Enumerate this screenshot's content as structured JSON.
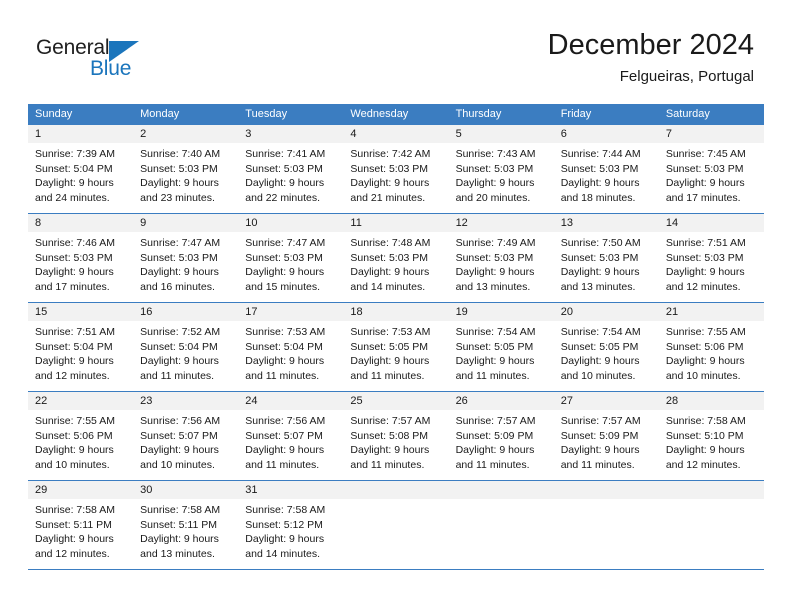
{
  "brand": {
    "word_one": "General",
    "word_two": "Blue",
    "accent_color": "#1b75bc",
    "logo_icon": "triangle-icon"
  },
  "header": {
    "title": "December 2024",
    "subtitle": "Felgueiras, Portugal"
  },
  "calendar": {
    "header_bg": "#3b7dc1",
    "day_number_bg": "#f2f2f2",
    "weekdays": [
      "Sunday",
      "Monday",
      "Tuesday",
      "Wednesday",
      "Thursday",
      "Friday",
      "Saturday"
    ],
    "weeks": [
      [
        {
          "day": "1",
          "sunrise": "Sunrise: 7:39 AM",
          "sunset": "Sunset: 5:04 PM",
          "daylight_1": "Daylight: 9 hours",
          "daylight_2": "and 24 minutes."
        },
        {
          "day": "2",
          "sunrise": "Sunrise: 7:40 AM",
          "sunset": "Sunset: 5:03 PM",
          "daylight_1": "Daylight: 9 hours",
          "daylight_2": "and 23 minutes."
        },
        {
          "day": "3",
          "sunrise": "Sunrise: 7:41 AM",
          "sunset": "Sunset: 5:03 PM",
          "daylight_1": "Daylight: 9 hours",
          "daylight_2": "and 22 minutes."
        },
        {
          "day": "4",
          "sunrise": "Sunrise: 7:42 AM",
          "sunset": "Sunset: 5:03 PM",
          "daylight_1": "Daylight: 9 hours",
          "daylight_2": "and 21 minutes."
        },
        {
          "day": "5",
          "sunrise": "Sunrise: 7:43 AM",
          "sunset": "Sunset: 5:03 PM",
          "daylight_1": "Daylight: 9 hours",
          "daylight_2": "and 20 minutes."
        },
        {
          "day": "6",
          "sunrise": "Sunrise: 7:44 AM",
          "sunset": "Sunset: 5:03 PM",
          "daylight_1": "Daylight: 9 hours",
          "daylight_2": "and 18 minutes."
        },
        {
          "day": "7",
          "sunrise": "Sunrise: 7:45 AM",
          "sunset": "Sunset: 5:03 PM",
          "daylight_1": "Daylight: 9 hours",
          "daylight_2": "and 17 minutes."
        }
      ],
      [
        {
          "day": "8",
          "sunrise": "Sunrise: 7:46 AM",
          "sunset": "Sunset: 5:03 PM",
          "daylight_1": "Daylight: 9 hours",
          "daylight_2": "and 17 minutes."
        },
        {
          "day": "9",
          "sunrise": "Sunrise: 7:47 AM",
          "sunset": "Sunset: 5:03 PM",
          "daylight_1": "Daylight: 9 hours",
          "daylight_2": "and 16 minutes."
        },
        {
          "day": "10",
          "sunrise": "Sunrise: 7:47 AM",
          "sunset": "Sunset: 5:03 PM",
          "daylight_1": "Daylight: 9 hours",
          "daylight_2": "and 15 minutes."
        },
        {
          "day": "11",
          "sunrise": "Sunrise: 7:48 AM",
          "sunset": "Sunset: 5:03 PM",
          "daylight_1": "Daylight: 9 hours",
          "daylight_2": "and 14 minutes."
        },
        {
          "day": "12",
          "sunrise": "Sunrise: 7:49 AM",
          "sunset": "Sunset: 5:03 PM",
          "daylight_1": "Daylight: 9 hours",
          "daylight_2": "and 13 minutes."
        },
        {
          "day": "13",
          "sunrise": "Sunrise: 7:50 AM",
          "sunset": "Sunset: 5:03 PM",
          "daylight_1": "Daylight: 9 hours",
          "daylight_2": "and 13 minutes."
        },
        {
          "day": "14",
          "sunrise": "Sunrise: 7:51 AM",
          "sunset": "Sunset: 5:03 PM",
          "daylight_1": "Daylight: 9 hours",
          "daylight_2": "and 12 minutes."
        }
      ],
      [
        {
          "day": "15",
          "sunrise": "Sunrise: 7:51 AM",
          "sunset": "Sunset: 5:04 PM",
          "daylight_1": "Daylight: 9 hours",
          "daylight_2": "and 12 minutes."
        },
        {
          "day": "16",
          "sunrise": "Sunrise: 7:52 AM",
          "sunset": "Sunset: 5:04 PM",
          "daylight_1": "Daylight: 9 hours",
          "daylight_2": "and 11 minutes."
        },
        {
          "day": "17",
          "sunrise": "Sunrise: 7:53 AM",
          "sunset": "Sunset: 5:04 PM",
          "daylight_1": "Daylight: 9 hours",
          "daylight_2": "and 11 minutes."
        },
        {
          "day": "18",
          "sunrise": "Sunrise: 7:53 AM",
          "sunset": "Sunset: 5:05 PM",
          "daylight_1": "Daylight: 9 hours",
          "daylight_2": "and 11 minutes."
        },
        {
          "day": "19",
          "sunrise": "Sunrise: 7:54 AM",
          "sunset": "Sunset: 5:05 PM",
          "daylight_1": "Daylight: 9 hours",
          "daylight_2": "and 11 minutes."
        },
        {
          "day": "20",
          "sunrise": "Sunrise: 7:54 AM",
          "sunset": "Sunset: 5:05 PM",
          "daylight_1": "Daylight: 9 hours",
          "daylight_2": "and 10 minutes."
        },
        {
          "day": "21",
          "sunrise": "Sunrise: 7:55 AM",
          "sunset": "Sunset: 5:06 PM",
          "daylight_1": "Daylight: 9 hours",
          "daylight_2": "and 10 minutes."
        }
      ],
      [
        {
          "day": "22",
          "sunrise": "Sunrise: 7:55 AM",
          "sunset": "Sunset: 5:06 PM",
          "daylight_1": "Daylight: 9 hours",
          "daylight_2": "and 10 minutes."
        },
        {
          "day": "23",
          "sunrise": "Sunrise: 7:56 AM",
          "sunset": "Sunset: 5:07 PM",
          "daylight_1": "Daylight: 9 hours",
          "daylight_2": "and 10 minutes."
        },
        {
          "day": "24",
          "sunrise": "Sunrise: 7:56 AM",
          "sunset": "Sunset: 5:07 PM",
          "daylight_1": "Daylight: 9 hours",
          "daylight_2": "and 11 minutes."
        },
        {
          "day": "25",
          "sunrise": "Sunrise: 7:57 AM",
          "sunset": "Sunset: 5:08 PM",
          "daylight_1": "Daylight: 9 hours",
          "daylight_2": "and 11 minutes."
        },
        {
          "day": "26",
          "sunrise": "Sunrise: 7:57 AM",
          "sunset": "Sunset: 5:09 PM",
          "daylight_1": "Daylight: 9 hours",
          "daylight_2": "and 11 minutes."
        },
        {
          "day": "27",
          "sunrise": "Sunrise: 7:57 AM",
          "sunset": "Sunset: 5:09 PM",
          "daylight_1": "Daylight: 9 hours",
          "daylight_2": "and 11 minutes."
        },
        {
          "day": "28",
          "sunrise": "Sunrise: 7:58 AM",
          "sunset": "Sunset: 5:10 PM",
          "daylight_1": "Daylight: 9 hours",
          "daylight_2": "and 12 minutes."
        }
      ],
      [
        {
          "day": "29",
          "sunrise": "Sunrise: 7:58 AM",
          "sunset": "Sunset: 5:11 PM",
          "daylight_1": "Daylight: 9 hours",
          "daylight_2": "and 12 minutes."
        },
        {
          "day": "30",
          "sunrise": "Sunrise: 7:58 AM",
          "sunset": "Sunset: 5:11 PM",
          "daylight_1": "Daylight: 9 hours",
          "daylight_2": "and 13 minutes."
        },
        {
          "day": "31",
          "sunrise": "Sunrise: 7:58 AM",
          "sunset": "Sunset: 5:12 PM",
          "daylight_1": "Daylight: 9 hours",
          "daylight_2": "and 14 minutes."
        },
        {
          "day": "",
          "sunrise": "",
          "sunset": "",
          "daylight_1": "",
          "daylight_2": ""
        },
        {
          "day": "",
          "sunrise": "",
          "sunset": "",
          "daylight_1": "",
          "daylight_2": ""
        },
        {
          "day": "",
          "sunrise": "",
          "sunset": "",
          "daylight_1": "",
          "daylight_2": ""
        },
        {
          "day": "",
          "sunrise": "",
          "sunset": "",
          "daylight_1": "",
          "daylight_2": ""
        }
      ]
    ]
  }
}
